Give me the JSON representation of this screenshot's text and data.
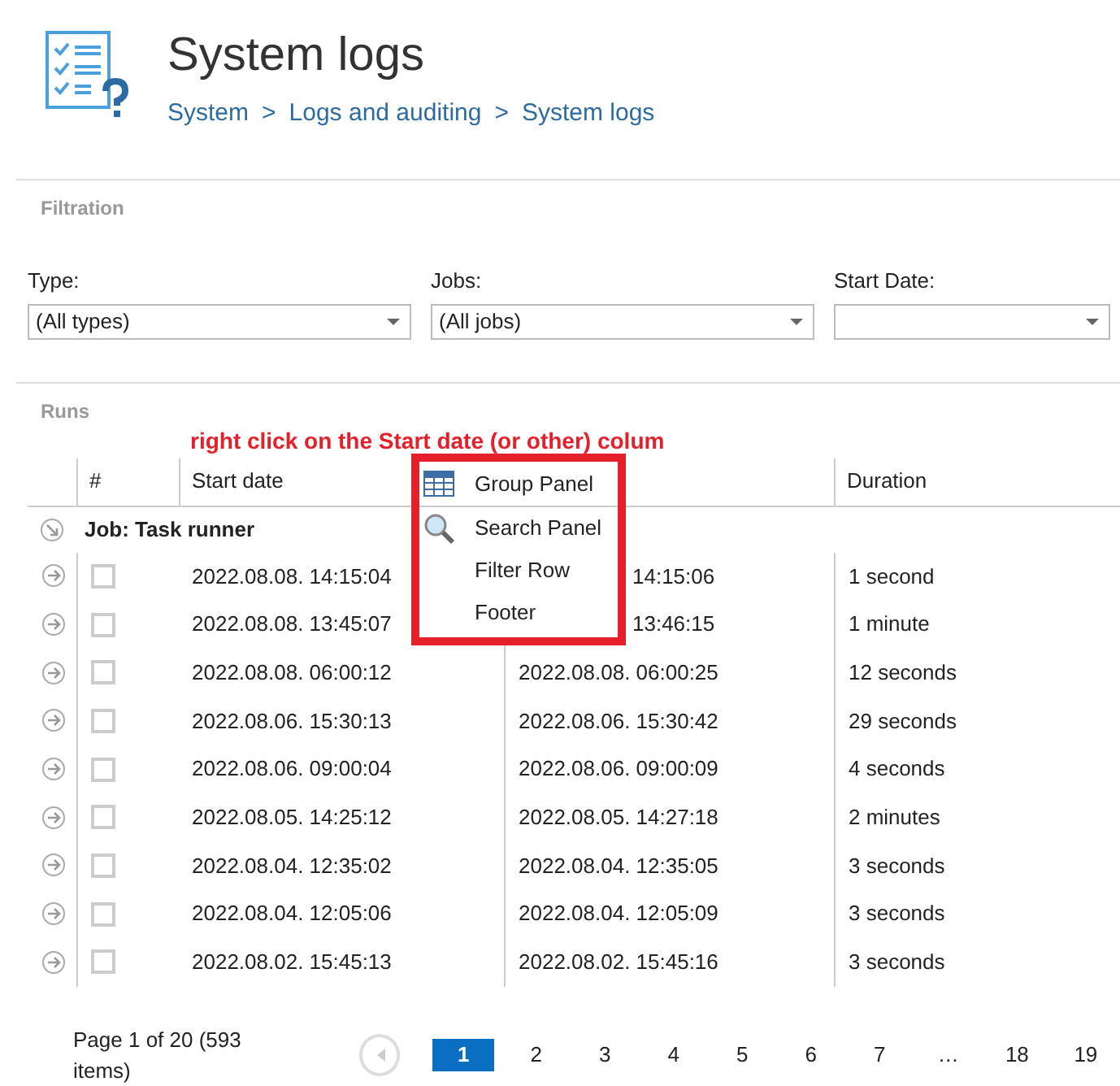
{
  "header": {
    "title": "System logs",
    "breadcrumb": [
      "System",
      "Logs and auditing",
      "System logs"
    ],
    "separator": ">"
  },
  "filtration": {
    "title": "Filtration",
    "filters": [
      {
        "label": "Type:",
        "value": "(All types)"
      },
      {
        "label": "Jobs:",
        "value": "(All jobs)"
      },
      {
        "label": "Start Date:"
      }
    ]
  },
  "runs": {
    "title": "Runs",
    "annotation": "right click on the Start date (or other) colum",
    "headers": [
      "#",
      "Start date",
      "Duration"
    ],
    "group": "Job: Task runner",
    "rows": [
      {
        "start": "2022.08.08. 14:15:04",
        "end": "14:15:06",
        "clipped": true,
        "duration": "1 second",
        "checked": false
      },
      {
        "start": "2022.08.08. 13:45:07",
        "end": "13:46:15",
        "clipped": true,
        "duration": "1 minute",
        "checked": false
      },
      {
        "start": "2022.08.08. 06:00:12",
        "end": "2022.08.08. 06:00:25",
        "clipped": false,
        "duration": "12 seconds",
        "checked": false
      },
      {
        "start": "2022.08.06. 15:30:13",
        "end": "2022.08.06. 15:30:42",
        "clipped": false,
        "duration": "29 seconds",
        "checked": false
      },
      {
        "start": "2022.08.06. 09:00:04",
        "end": "2022.08.06. 09:00:09",
        "clipped": false,
        "duration": "4 seconds",
        "checked": false
      },
      {
        "start": "2022.08.05. 14:25:12",
        "end": "2022.08.05. 14:27:18",
        "clipped": false,
        "duration": "2 minutes",
        "checked": false
      },
      {
        "start": "2022.08.04. 12:35:02",
        "end": "2022.08.04. 12:35:05",
        "clipped": false,
        "duration": "3 seconds",
        "checked": false
      },
      {
        "start": "2022.08.04. 12:05:06",
        "end": "2022.08.04. 12:05:09",
        "clipped": false,
        "duration": "3 seconds",
        "checked": false
      },
      {
        "start": "2022.08.02. 15:45:13",
        "end": "2022.08.02. 15:45:16",
        "clipped": false,
        "duration": "3 seconds",
        "checked": false
      }
    ],
    "menu": [
      {
        "label": "Group Panel",
        "kind": "grid"
      },
      {
        "label": "Search Panel",
        "kind": "search"
      },
      {
        "label": "Filter Row",
        "kind": "plain"
      },
      {
        "label": "Footer",
        "kind": "plain"
      }
    ]
  },
  "pager": {
    "summary": "Page 1 of 20 (593 items)",
    "pages": [
      {
        "label": "1",
        "selected": true
      },
      {
        "label": "2",
        "selected": false
      },
      {
        "label": "3",
        "selected": false
      },
      {
        "label": "4",
        "selected": false
      },
      {
        "label": "5",
        "selected": false
      },
      {
        "label": "6",
        "selected": false
      },
      {
        "label": "7",
        "selected": false
      },
      {
        "label": "…",
        "selected": false
      },
      {
        "label": "18",
        "selected": false
      },
      {
        "label": "19",
        "selected": false
      }
    ]
  }
}
